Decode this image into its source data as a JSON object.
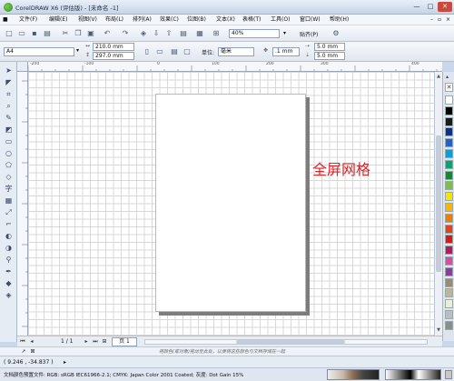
{
  "window": {
    "title": "CorelDRAW X6 (评估版) - [未命名 -1]",
    "controls": [
      "—",
      "□",
      "✕"
    ]
  },
  "menubar": {
    "items": [
      "文件(F)",
      "编辑(E)",
      "视图(V)",
      "布局(L)",
      "排列(A)",
      "效果(C)",
      "位图(B)",
      "文本(X)",
      "表格(T)",
      "工具(O)",
      "窗口(W)",
      "帮助(H)"
    ]
  },
  "std_toolbar": {
    "zoom_value": "40%",
    "snap_label": "贴齐(P)"
  },
  "prop_toolbar": {
    "page_size": "A4",
    "width": "210.0 mm",
    "height": "297.0 mm",
    "units_label": "单位:",
    "units_value": "毫米",
    "nudge": ".1 mm",
    "dup_x": "5.0 mm",
    "dup_y": "5.0 mm"
  },
  "annotation": "全屏网格",
  "page_nav": {
    "counter": "1 / 1",
    "tab": "页 1"
  },
  "hint": "将颜色(或对象)拖动至此处，以便将这些颜色与文档存储在一起",
  "status": {
    "coords": "( 9.246 , -34.837 )",
    "color_profile": "文档颜色预置文件: RGB: sRGB IEC61966-2.1; CMYK: Japan Color 2001 Coated; 灰度: Dot Gain 15%"
  },
  "palette_colors": [
    "#ffffff",
    "#000000",
    "#1a1a1a",
    "#0f2f8e",
    "#1f5fd8",
    "#00a0e6",
    "#00a86b",
    "#108a2b",
    "#7cc242",
    "#f2e600",
    "#ffb400",
    "#f07d00",
    "#e8401c",
    "#d7181f",
    "#b21b5f",
    "#d64ea0",
    "#8d3c9a",
    "#9d8a70",
    "#c4b496",
    "#f0ecd4",
    "#bdbdbd",
    "#8c8c8c"
  ],
  "rulers": {
    "h_ticks": [
      "-200",
      "-100",
      "0",
      "100",
      "200",
      "300",
      "400"
    ],
    "v_ticks": [
      "300",
      "200",
      "100",
      "0"
    ]
  }
}
